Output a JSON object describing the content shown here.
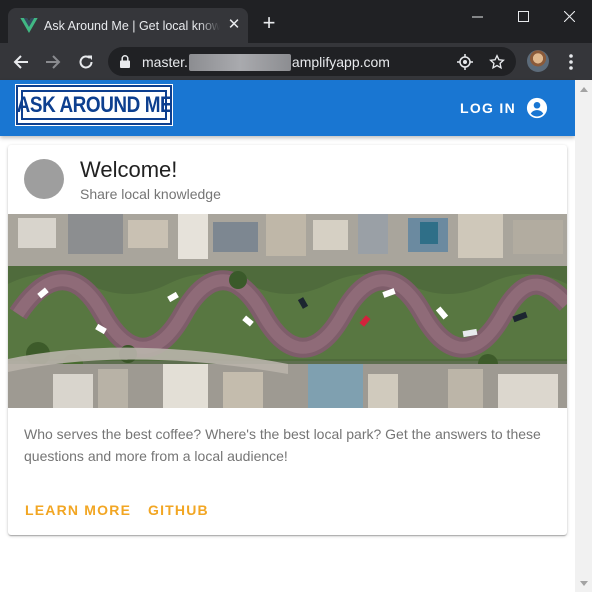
{
  "browser": {
    "tab_title": "Ask Around Me | Get local knowledge",
    "url_prefix": "master.",
    "url_suffix": "amplifyapp.com"
  },
  "app": {
    "logo_text": "ASK AROUND ME",
    "login_label": "LOG IN",
    "brand_color": "#1976d2",
    "accent_color": "#f2a623"
  },
  "card": {
    "title": "Welcome!",
    "subtitle": "Share local knowledge",
    "description": "Who serves the best coffee? Where's the best local park? Get the answers to these questions and more from a local audience!",
    "actions": [
      "LEARN MORE",
      "GITHUB"
    ]
  }
}
